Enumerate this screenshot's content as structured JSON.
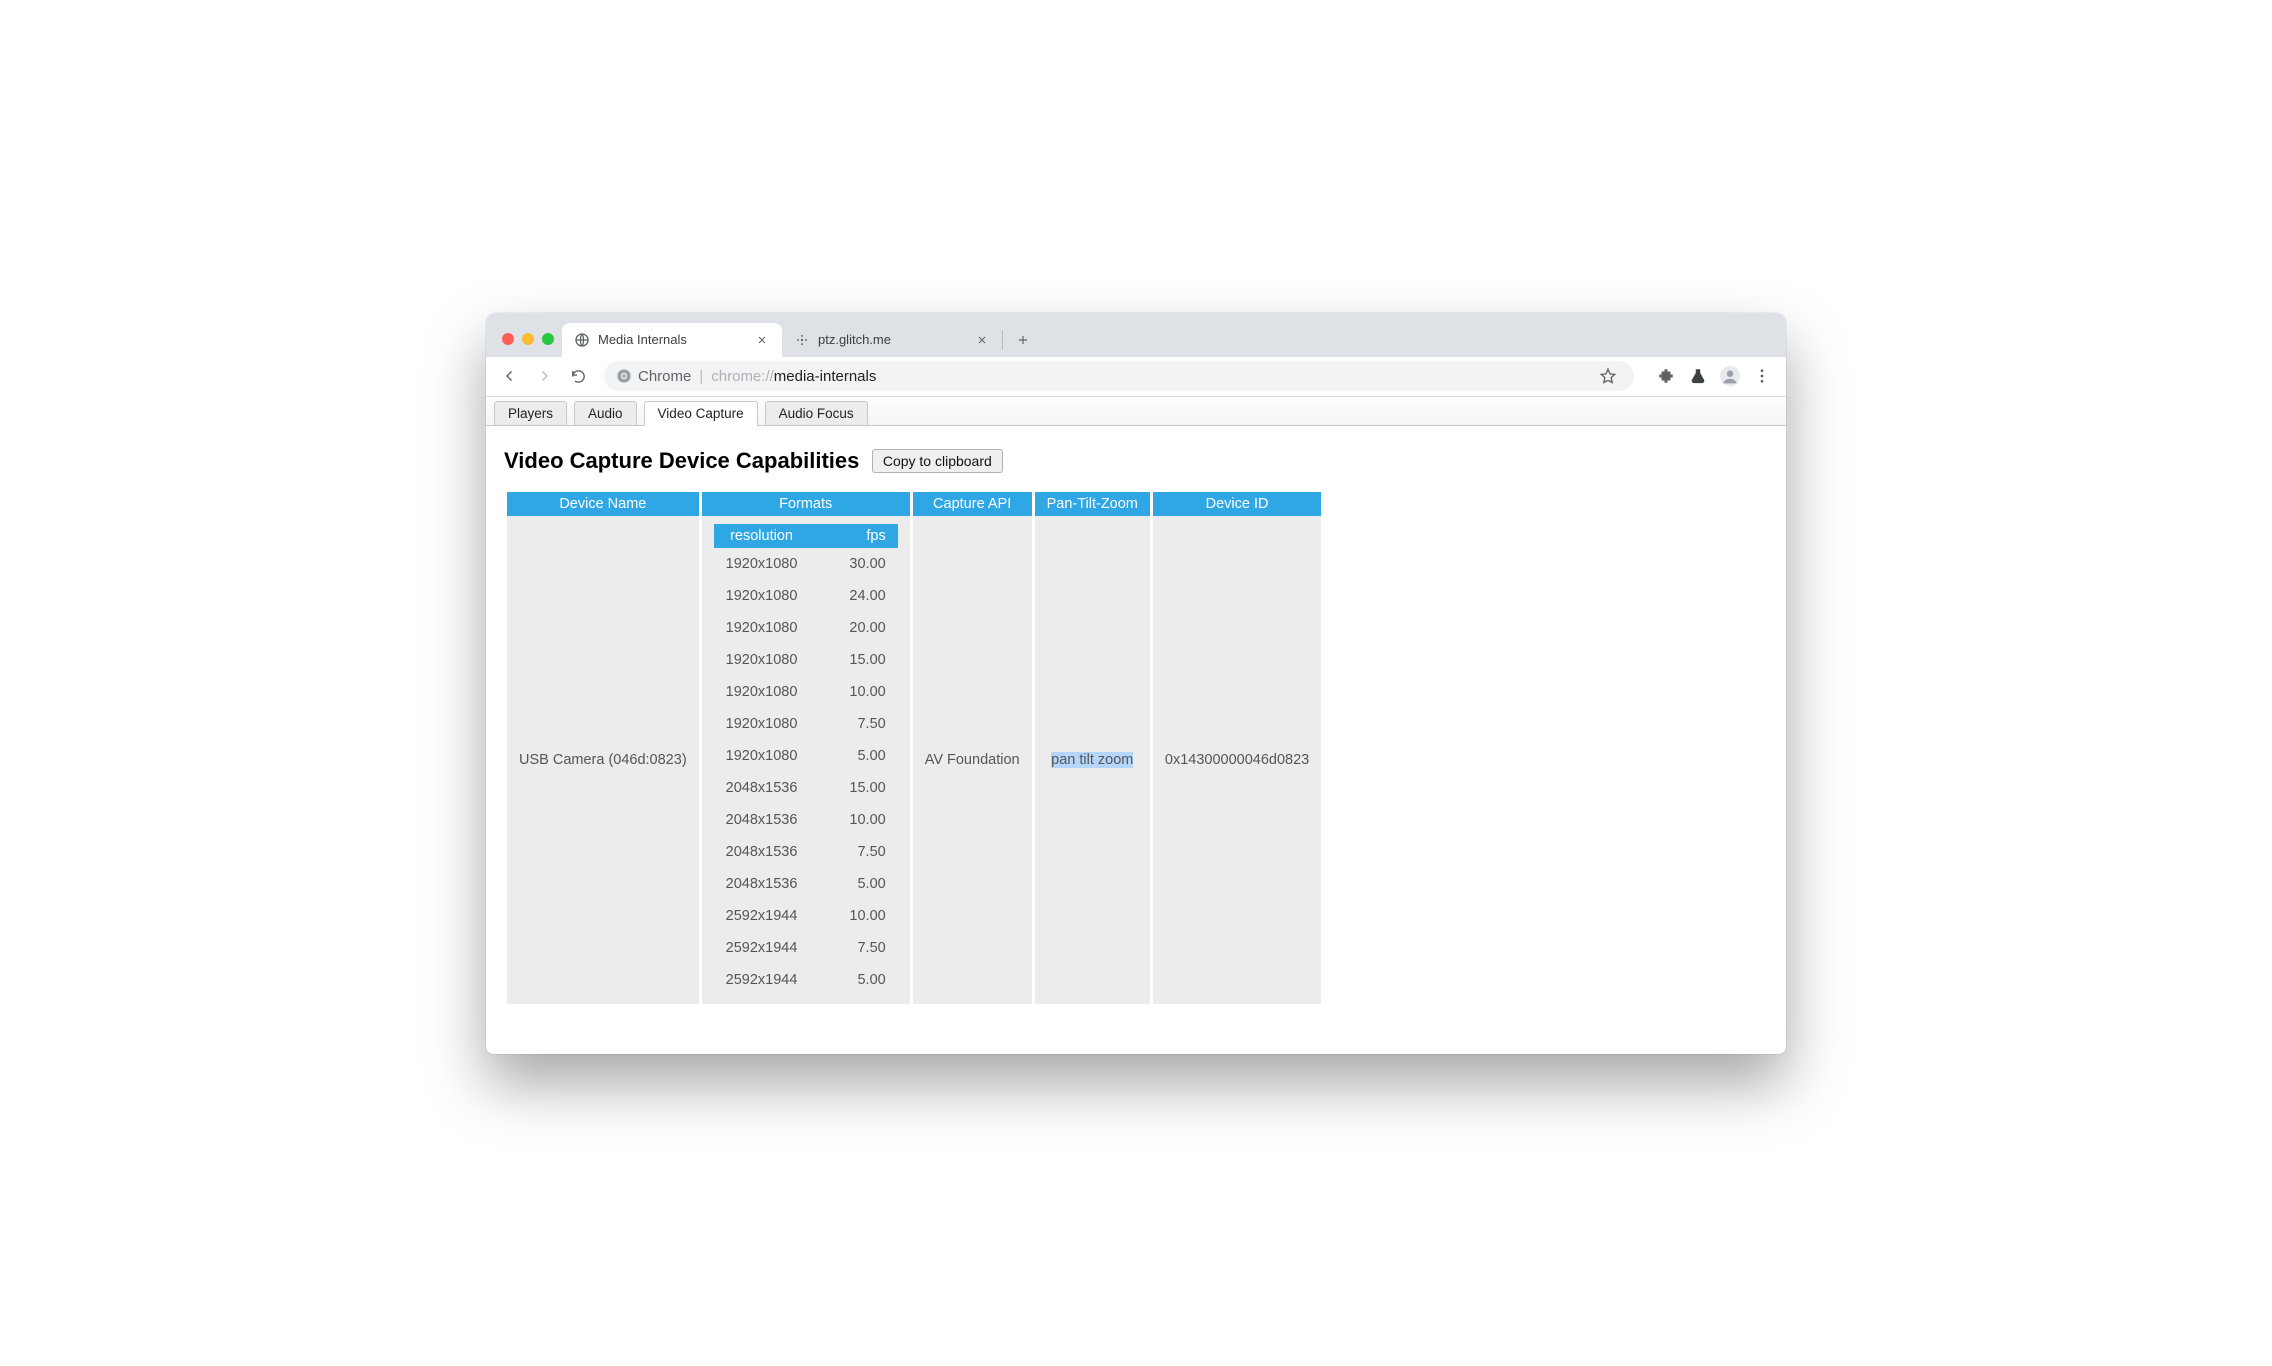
{
  "browser": {
    "tabs": [
      {
        "title": "Media Internals",
        "active": true
      },
      {
        "title": "ptz.glitch.me",
        "active": false
      }
    ],
    "omnibox": {
      "chip": "Chrome",
      "url_prefix": "chrome://",
      "url_path": "media-internals"
    }
  },
  "inner_tabs": [
    {
      "label": "Players",
      "active": false
    },
    {
      "label": "Audio",
      "active": false
    },
    {
      "label": "Video Capture",
      "active": true
    },
    {
      "label": "Audio Focus",
      "active": false
    }
  ],
  "heading": "Video Capture Device Capabilities",
  "copy_button": "Copy to clipboard",
  "columns": [
    "Device Name",
    "Formats",
    "Capture API",
    "Pan-Tilt-Zoom",
    "Device ID"
  ],
  "format_headers": {
    "res": "resolution",
    "fps": "fps"
  },
  "device": {
    "name": "USB Camera (046d:0823)",
    "capture_api": "AV Foundation",
    "ptz": "pan tilt zoom",
    "id": "0x14300000046d0823",
    "formats": [
      {
        "res": "1920x1080",
        "fps": "30.00"
      },
      {
        "res": "1920x1080",
        "fps": "24.00"
      },
      {
        "res": "1920x1080",
        "fps": "20.00"
      },
      {
        "res": "1920x1080",
        "fps": "15.00"
      },
      {
        "res": "1920x1080",
        "fps": "10.00"
      },
      {
        "res": "1920x1080",
        "fps": "7.50"
      },
      {
        "res": "1920x1080",
        "fps": "5.00"
      },
      {
        "res": "2048x1536",
        "fps": "15.00"
      },
      {
        "res": "2048x1536",
        "fps": "10.00"
      },
      {
        "res": "2048x1536",
        "fps": "7.50"
      },
      {
        "res": "2048x1536",
        "fps": "5.00"
      },
      {
        "res": "2592x1944",
        "fps": "10.00"
      },
      {
        "res": "2592x1944",
        "fps": "7.50"
      },
      {
        "res": "2592x1944",
        "fps": "5.00"
      }
    ]
  }
}
